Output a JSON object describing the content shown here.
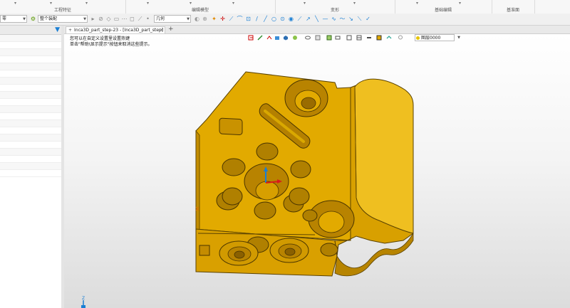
{
  "ribbon": {
    "groups": [
      {
        "label": "工程特征"
      },
      {
        "label": "编辑模型"
      },
      {
        "label": "变形"
      },
      {
        "label": "基础编辑"
      },
      {
        "label": "基准面"
      }
    ]
  },
  "toolbar": {
    "filter_select": {
      "value": "零"
    },
    "assembly_select": {
      "value": "整个装配"
    },
    "snap_select": {
      "value": "几何"
    }
  },
  "document_tab": {
    "label": "Inca3D_part_step-23 - [Inca3D_part_step]",
    "close": "×",
    "pin": "+",
    "add": "+"
  },
  "viewport": {
    "hints": [
      "您可以在自定义设置里设置热键",
      "单击\"帮助\\显示提示\"按钮来取消这些提示。"
    ],
    "display_select": {
      "value": "图层0000"
    },
    "triad_label": "Z"
  },
  "colors": {
    "model_face": "#e0a800",
    "model_edge": "#4a3500",
    "accent": "#1a7fd4"
  }
}
